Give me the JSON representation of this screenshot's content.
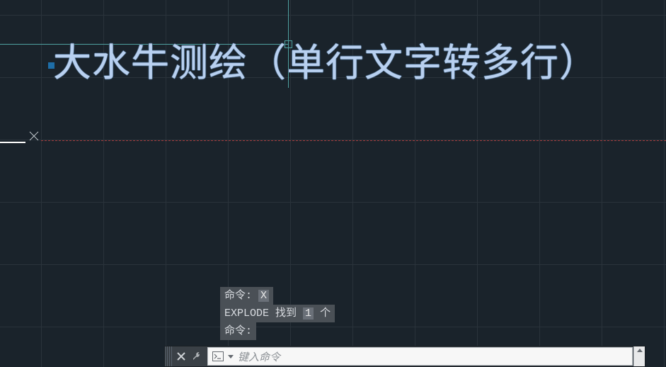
{
  "drawing": {
    "text_content": "大水牛测绘（单行文字转多行）"
  },
  "history": {
    "line1_prefix": "命令:",
    "line1_cmd": "X",
    "line2_left": "EXPLODE 找到",
    "line2_count": "1",
    "line2_suffix": "个",
    "line3": "命令:"
  },
  "commandbar": {
    "placeholder": "键入命令"
  },
  "icons": {
    "close": "close-icon",
    "wrench": "wrench-icon",
    "terminal": "terminal-icon",
    "recent_dropdown": "chevron-down-icon",
    "expand_up": "chevron-up-icon",
    "x_marker": "x-marker-icon"
  }
}
